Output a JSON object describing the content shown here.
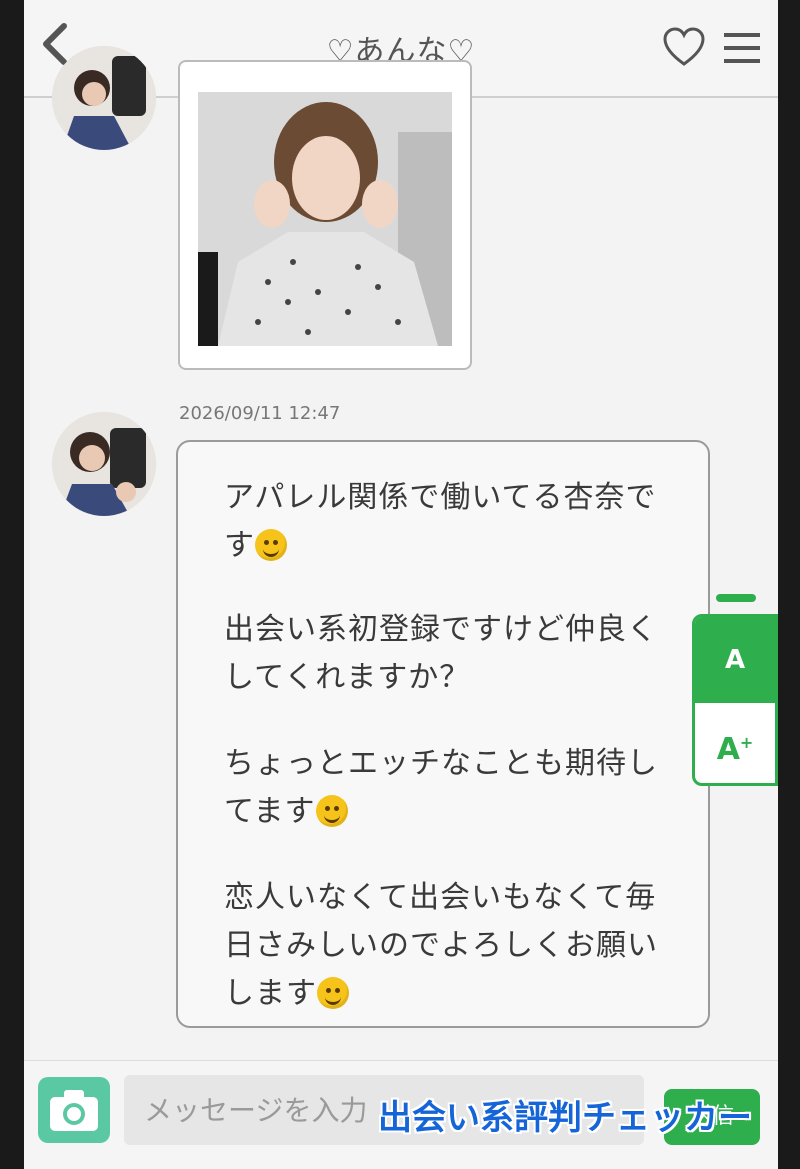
{
  "header": {
    "title": "♡あんな♡"
  },
  "messages": [
    {
      "type": "image",
      "sender": "あんな"
    },
    {
      "type": "text",
      "timestamp": "2026/09/11 12:47",
      "lines": [
        "アパレル関係で働いてる杏奈で",
        "す",
        "出会い系初登録ですけど仲良く",
        "してくれますか？",
        "ちょっとエッチなことも期待し",
        "てます",
        "恋人いなくて出会いもなくて毎",
        "日さみしいのでよろしくお願い",
        "します"
      ],
      "emoji": [
        "smiling-face",
        "smiling-face",
        "grinning-face"
      ]
    }
  ],
  "font_size_panel": {
    "normal_label": "A",
    "large_label": "A",
    "large_sup": "+"
  },
  "composer": {
    "placeholder": "メッセージを入力",
    "send_label": "送信"
  },
  "watermark": "出会い系評判チェッカー",
  "colors": {
    "accent": "#2fae4e",
    "camera": "#5ac8a2",
    "watermark": "#1565d8"
  }
}
